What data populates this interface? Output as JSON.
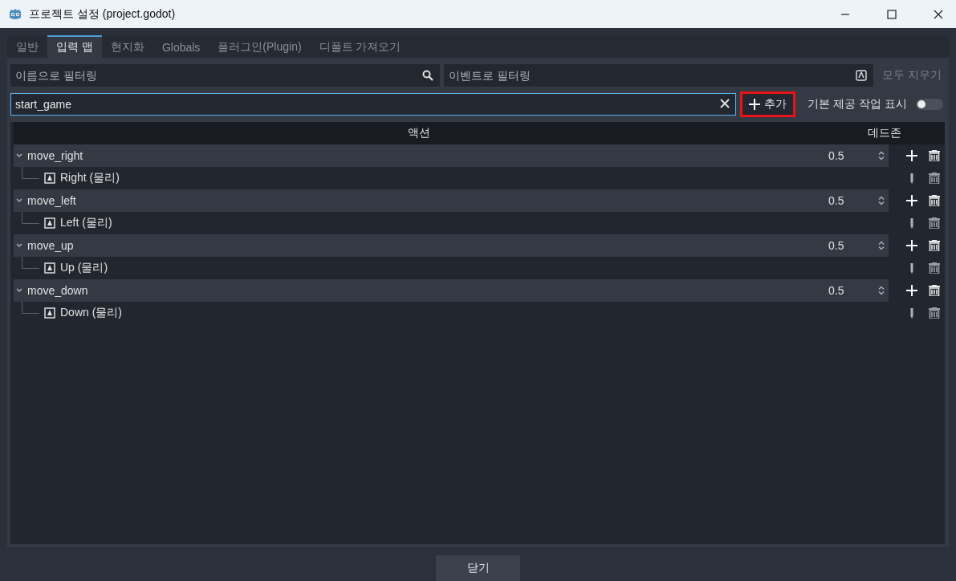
{
  "window": {
    "title": "프로젝트 설정 (project.godot)"
  },
  "tabs": [
    {
      "label": "일반",
      "selected": false
    },
    {
      "label": "입력 맵",
      "selected": true
    },
    {
      "label": "현지화",
      "selected": false
    },
    {
      "label": "Globals",
      "selected": false
    },
    {
      "label": "플러그인(Plugin)",
      "selected": false
    },
    {
      "label": "디폴트 가져오기",
      "selected": false
    }
  ],
  "filters": {
    "name_placeholder": "이름으로 필터링",
    "event_placeholder": "이벤트로 필터링",
    "clear_all": "모두 지우기"
  },
  "add_row": {
    "value": "start_game",
    "add_button": "추가",
    "add_highlighted": true,
    "builtin_label": "기본 제공 작업 표시",
    "builtin_on": false
  },
  "table": {
    "columns": [
      "액션",
      "데드존"
    ],
    "actions": [
      {
        "name": "move_right",
        "expanded": true,
        "deadzone": "0.5",
        "children": [
          {
            "name": "Right (물리)"
          }
        ]
      },
      {
        "name": "move_left",
        "expanded": true,
        "deadzone": "0.5",
        "children": [
          {
            "name": "Left (물리)"
          }
        ]
      },
      {
        "name": "move_up",
        "expanded": true,
        "deadzone": "0.5",
        "children": [
          {
            "name": "Up (물리)"
          }
        ]
      },
      {
        "name": "move_down",
        "expanded": true,
        "deadzone": "0.5",
        "children": [
          {
            "name": "Down (물리)"
          }
        ]
      }
    ]
  },
  "close_button": "닫기"
}
